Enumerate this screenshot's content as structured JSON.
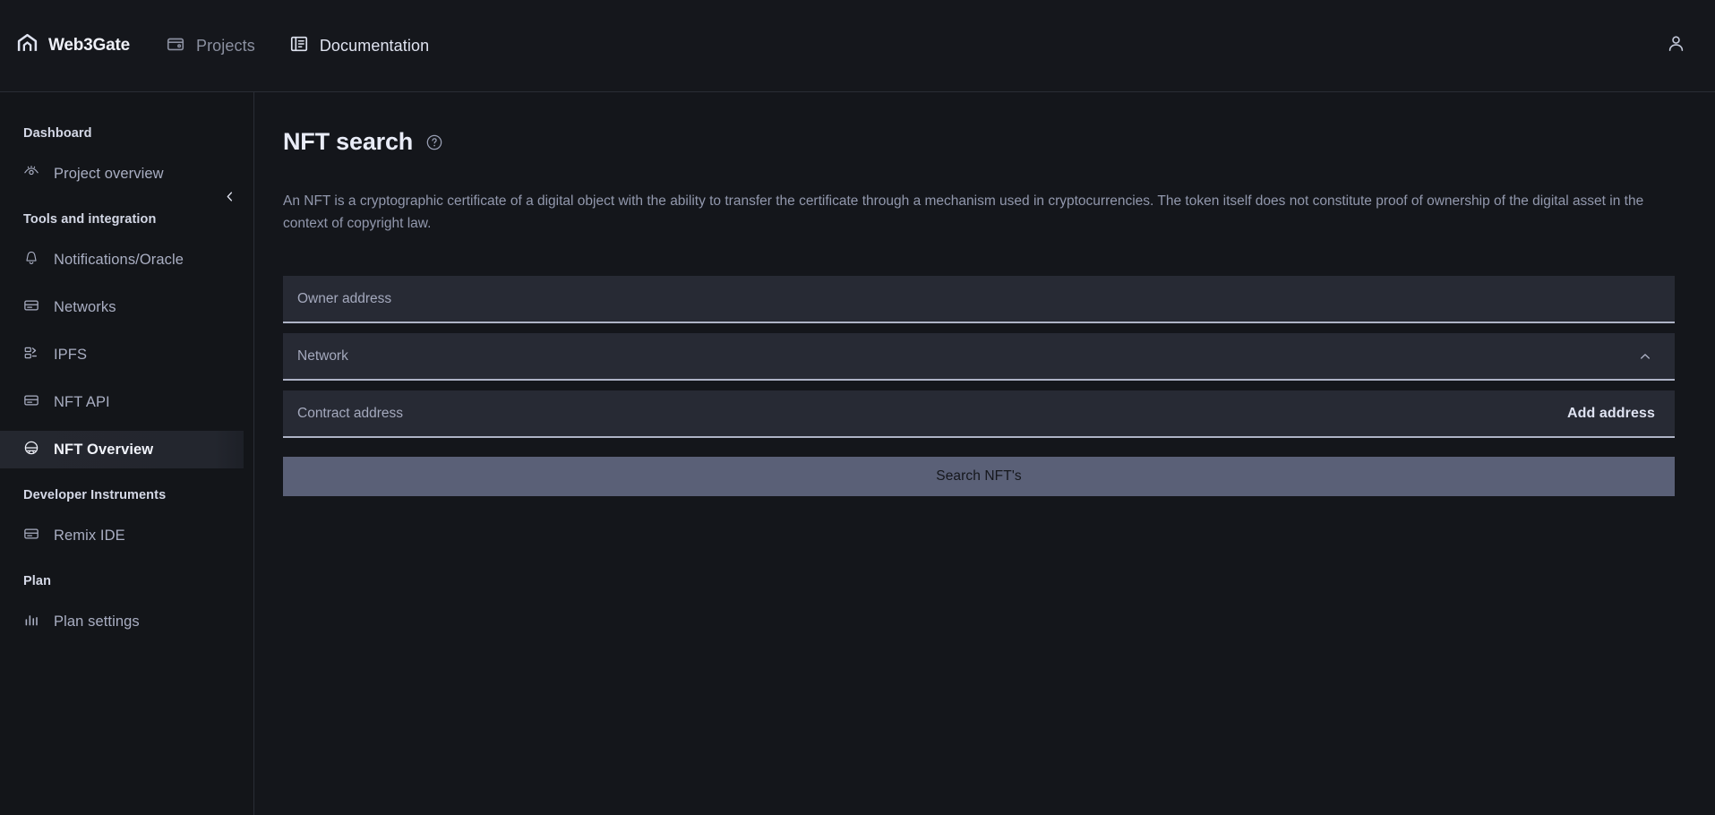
{
  "header": {
    "brand": {
      "name": "Web3Gate",
      "icon": "web3gate-logo-icon"
    },
    "nav": [
      {
        "label": "Projects",
        "icon": "projects-wallet-icon",
        "state": "muted"
      },
      {
        "label": "Documentation",
        "icon": "documentation-book-icon",
        "state": "bright"
      }
    ],
    "account_icon": "user-account-icon"
  },
  "sidebar": {
    "collapse_icon": "chevron-left-icon",
    "groups": [
      {
        "title": "Dashboard",
        "items": [
          {
            "label": "Project overview",
            "icon": "eye-icon",
            "active": false
          }
        ]
      },
      {
        "title": "Tools and integration",
        "items": [
          {
            "label": "Notifications/Oracle",
            "icon": "bell-icon",
            "active": false
          },
          {
            "label": "Networks",
            "icon": "network-card-icon",
            "active": false
          },
          {
            "label": "IPFS",
            "icon": "ipfs-blocks-icon",
            "active": false
          },
          {
            "label": "NFT API",
            "icon": "api-card-icon",
            "active": false
          },
          {
            "label": "NFT Overview",
            "icon": "nft-overview-icon",
            "active": true
          }
        ]
      },
      {
        "title": "Developer Instruments",
        "items": [
          {
            "label": "Remix IDE",
            "icon": "remix-ide-card-icon",
            "active": false
          }
        ]
      },
      {
        "title": "Plan",
        "items": [
          {
            "label": "Plan settings",
            "icon": "bar-chart-icon",
            "active": false
          }
        ]
      }
    ]
  },
  "main": {
    "title": "NFT search",
    "help_icon": "question-mark-circle-icon",
    "description": "An NFT is a cryptographic certificate of a digital object with the ability to transfer the certificate through a mechanism used in cryptocurrencies. The token itself does not constitute proof of ownership of the digital asset in the context of copyright law.",
    "form": {
      "owner_address": {
        "placeholder": "Owner address",
        "value": ""
      },
      "network": {
        "placeholder": "Network",
        "value": "",
        "chevron_icon": "chevron-up-icon"
      },
      "contract_address": {
        "placeholder": "Contract address",
        "value": "",
        "action_label": "Add address"
      },
      "submit_label": "Search NFT's"
    }
  },
  "colors": {
    "page_bg": "#14161b",
    "sidebar_bg": "#131519",
    "topbar_bg": "#15171c",
    "field_bg": "#272a34",
    "field_underline": "#aeb3c6",
    "submit_bg": "#5a6077",
    "active_item_bg": "#24272f",
    "text_primary": "#e9ecf7",
    "text_muted": "#9298ad",
    "border": "#2a2d35"
  }
}
